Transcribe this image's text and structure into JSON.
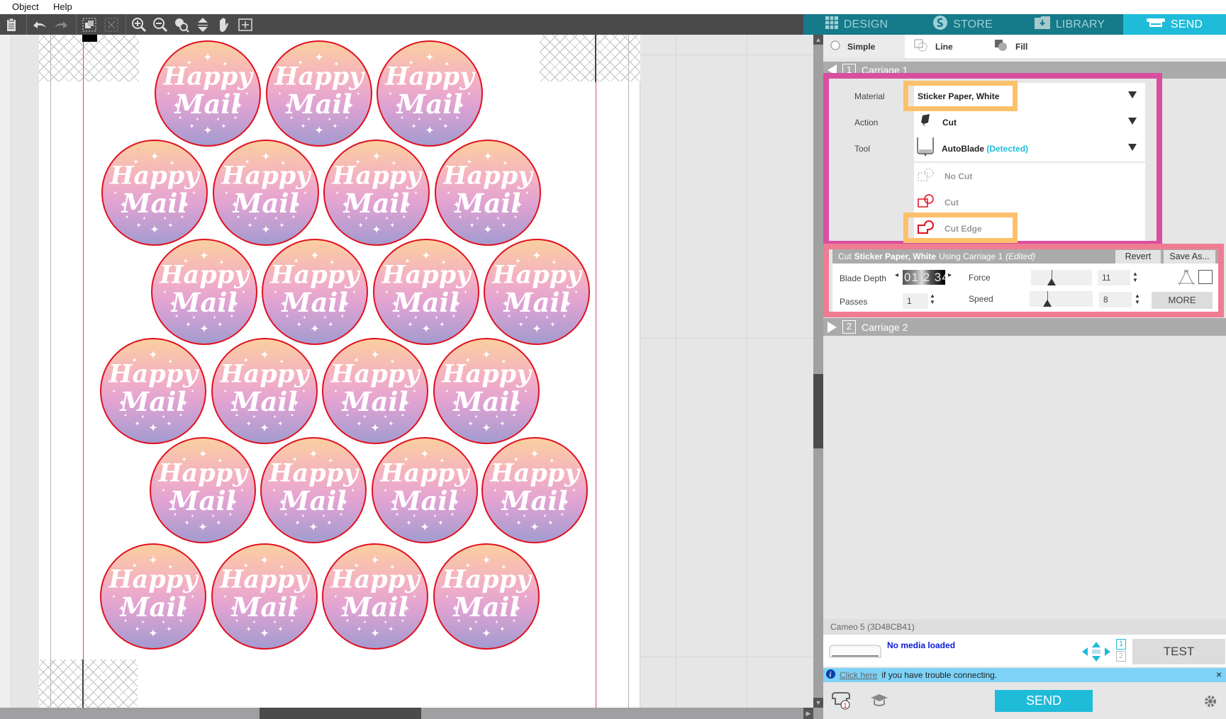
{
  "menu": {
    "items": [
      "Object",
      "Help"
    ]
  },
  "toolbar": {
    "icons": [
      "clipboard-icon",
      "undo-icon",
      "redo-icon",
      "group-icon",
      "ungroup-icon",
      "zoom-in-icon",
      "zoom-out-icon",
      "zoom-selection-icon",
      "fit-page-icon",
      "pan-hand-icon",
      "zoom-fit-icon"
    ]
  },
  "tabs": [
    {
      "label": "DESIGN",
      "icon": "grid-icon",
      "active": false
    },
    {
      "label": "STORE",
      "icon": "store-logo-icon",
      "active": false
    },
    {
      "label": "LIBRARY",
      "icon": "library-folder-icon",
      "active": false
    },
    {
      "label": "SEND",
      "icon": "cutter-icon",
      "active": true
    }
  ],
  "canvas": {
    "sticker_text_line1": "Happy",
    "sticker_text_line2": "Mail",
    "sticker_count": 23,
    "colors": {
      "cut_line": "#e01020",
      "gradient_top": "#fbcf9f",
      "gradient_mid": "#f3b0c4",
      "gradient_bottom": "#a39bd0"
    }
  },
  "send_panel": {
    "modes": [
      {
        "label": "Simple",
        "selected": true
      },
      {
        "label": "Line",
        "selected": false
      },
      {
        "label": "Fill",
        "selected": false
      }
    ],
    "carriage1": {
      "number": "1",
      "label": "Carriage 1",
      "expanded": true
    },
    "material": {
      "label": "Material",
      "value": "Sticker Paper, White"
    },
    "action": {
      "label": "Action",
      "value": "Cut"
    },
    "tool": {
      "label": "Tool",
      "value": "AutoBlade",
      "status": "(Detected)"
    },
    "cut_options": [
      {
        "label": "No Cut",
        "selected": false
      },
      {
        "label": "Cut",
        "selected": false
      },
      {
        "label": "Cut Edge",
        "selected": true
      }
    ],
    "cut_settings": {
      "header_prefix": "Cut",
      "header_material": "Sticker Paper, White",
      "header_suffix": "Using Carriage 1",
      "header_edited": "(Edited)",
      "revert_label": "Revert",
      "save_as_label": "Save As...",
      "blade_depth_label": "Blade Depth",
      "blade_depth_value": "2",
      "blade_depth_digits": "01 2 34",
      "passes_label": "Passes",
      "passes_value": "1",
      "force_label": "Force",
      "force_value": "11",
      "speed_label": "Speed",
      "speed_value": "8",
      "more_label": "MORE"
    },
    "carriage2": {
      "number": "2",
      "label": "Carriage 2",
      "expanded": false
    },
    "device_name": "Cameo 5 (3D48CB41)",
    "media_status": "No media loaded",
    "carriage_indicators": [
      "1",
      "2"
    ],
    "test_label": "TEST",
    "info": {
      "link": "Click here",
      "text": "if you have trouble connecting.",
      "close": "×"
    },
    "send_label": "SEND",
    "queue_badge": "1"
  },
  "colors": {
    "tab_bar": "#157a8a",
    "active_tab": "#1fbcd9",
    "highlight_magenta": "#d94fa0",
    "highlight_pink": "#ef7c93",
    "highlight_orange": "#fdc06a",
    "detected": "#1fbcd9",
    "media_status": "#0a1ad8"
  }
}
